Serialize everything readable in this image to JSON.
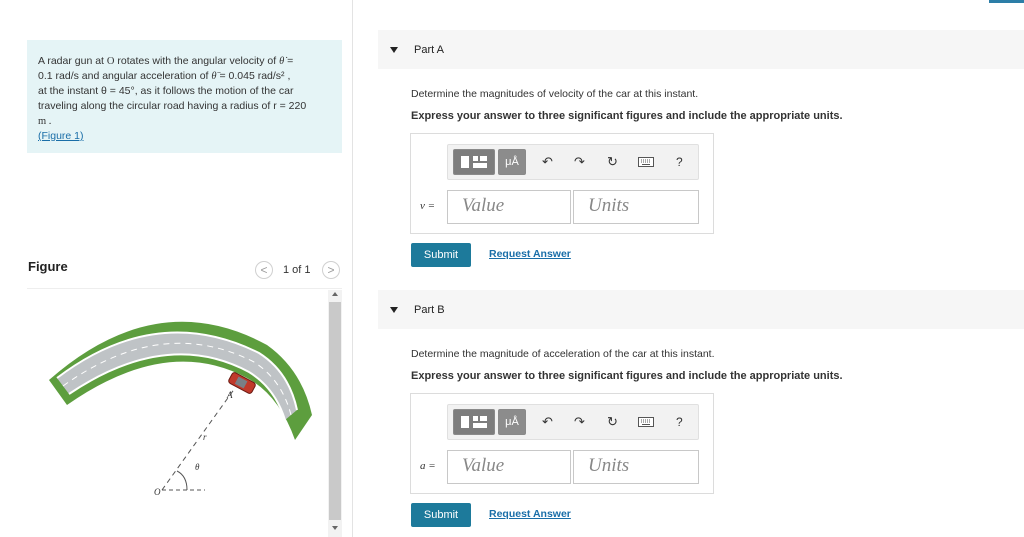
{
  "problem": {
    "line1_prefix": "A radar gun at ",
    "line1_O": "O",
    "line1_mid": " rotates with the angular velocity of ",
    "line1_theta_dot": "θ̇",
    "line1_eq": " =",
    "line2": "0.1 rad/s and angular acceleration of ",
    "line2_theta_ddot": "θ̈",
    "line2_rest": " = 0.045 rad/s² ,",
    "line3": "at the instant θ = 45°, as it follows the motion of the car",
    "line4": "traveling along the circular road having a radius of r = 220",
    "line5": "m .",
    "figure_link": "(Figure 1)"
  },
  "figure": {
    "title": "Figure",
    "counter": "1 of 1",
    "prev_glyph": "<",
    "next_glyph": ">",
    "label_A": "A",
    "label_r": "r",
    "label_theta": "θ",
    "label_O": "O"
  },
  "parts": [
    {
      "header": "Part A",
      "question": "Determine the magnitudes of velocity of the car at this instant.",
      "instruction": "Express your answer to three significant figures and include the appropriate units.",
      "variable": "v =",
      "value_placeholder": "Value",
      "units_placeholder": "Units",
      "submit": "Submit",
      "request": "Request Answer"
    },
    {
      "header": "Part B",
      "question": "Determine the magnitude of acceleration of the car at this instant.",
      "instruction": "Express your answer to three significant figures and include the appropriate units.",
      "variable": "a =",
      "value_placeholder": "Value",
      "units_placeholder": "Units",
      "submit": "Submit",
      "request": "Request Answer"
    }
  ],
  "toolbar": {
    "mu_label": "μÅ",
    "undo": "↶",
    "redo": "↷",
    "reset": "↻",
    "help": "?",
    "icons": [
      "templates-icon",
      "units-icon",
      "undo-icon",
      "redo-icon",
      "reset-icon",
      "keyboard-icon",
      "help-icon"
    ]
  },
  "colors": {
    "problem_bg": "#e5f4f6",
    "submit_bg": "#1d7a9b",
    "link": "#1a6ea8",
    "road_green": "#5d9e3e",
    "car_red": "#c0392b"
  }
}
